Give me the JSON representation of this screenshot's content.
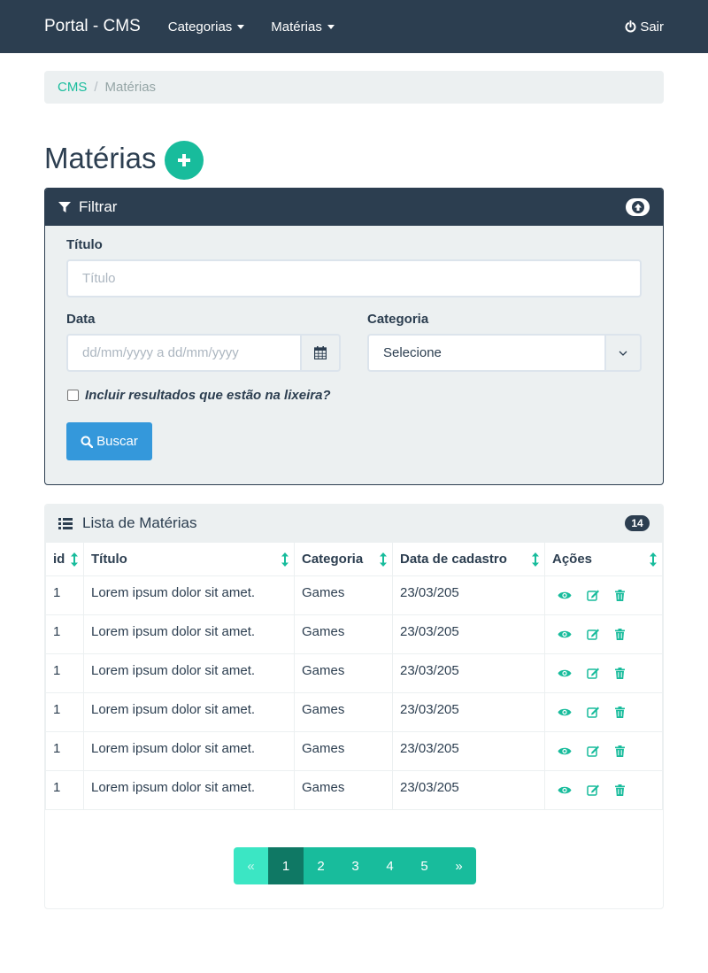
{
  "navbar": {
    "brand": "Portal - CMS",
    "menu": [
      {
        "label": "Categorias"
      },
      {
        "label": "Matérias"
      }
    ],
    "logout_label": "Sair"
  },
  "breadcrumb": {
    "root": "CMS",
    "separator": "/",
    "current": "Matérias"
  },
  "page": {
    "title": "Matérias"
  },
  "filter": {
    "title": "Filtrar",
    "titulo_label": "Título",
    "titulo_placeholder": "Título",
    "data_label": "Data",
    "data_placeholder": "dd/mm/yyyy a dd/mm/yyyy",
    "categoria_label": "Categoria",
    "categoria_value": "Selecione",
    "trash_label": "Incluir resultados que estão na lixeira?",
    "search_label": "Buscar"
  },
  "list": {
    "title": "Lista de Matérias",
    "count": "14",
    "columns": [
      "id",
      "Título",
      "Categoria",
      "Data de cadastro",
      "Ações"
    ],
    "rows": [
      {
        "id": "1",
        "titulo": "Lorem ipsum dolor sit amet.",
        "categoria": "Games",
        "data": "23/03/205"
      },
      {
        "id": "1",
        "titulo": "Lorem ipsum dolor sit amet.",
        "categoria": "Games",
        "data": "23/03/205"
      },
      {
        "id": "1",
        "titulo": "Lorem ipsum dolor sit amet.",
        "categoria": "Games",
        "data": "23/03/205"
      },
      {
        "id": "1",
        "titulo": "Lorem ipsum dolor sit amet.",
        "categoria": "Games",
        "data": "23/03/205"
      },
      {
        "id": "1",
        "titulo": "Lorem ipsum dolor sit amet.",
        "categoria": "Games",
        "data": "23/03/205"
      },
      {
        "id": "1",
        "titulo": "Lorem ipsum dolor sit amet.",
        "categoria": "Games",
        "data": "23/03/205"
      }
    ]
  },
  "pagination": {
    "prev": "«",
    "pages": [
      "1",
      "2",
      "3",
      "4",
      "5"
    ],
    "active": "1",
    "next": "»"
  },
  "colors": {
    "primary": "#2c3e50",
    "success": "#18bc9c",
    "info": "#3498db",
    "light": "#ecf0f1"
  }
}
